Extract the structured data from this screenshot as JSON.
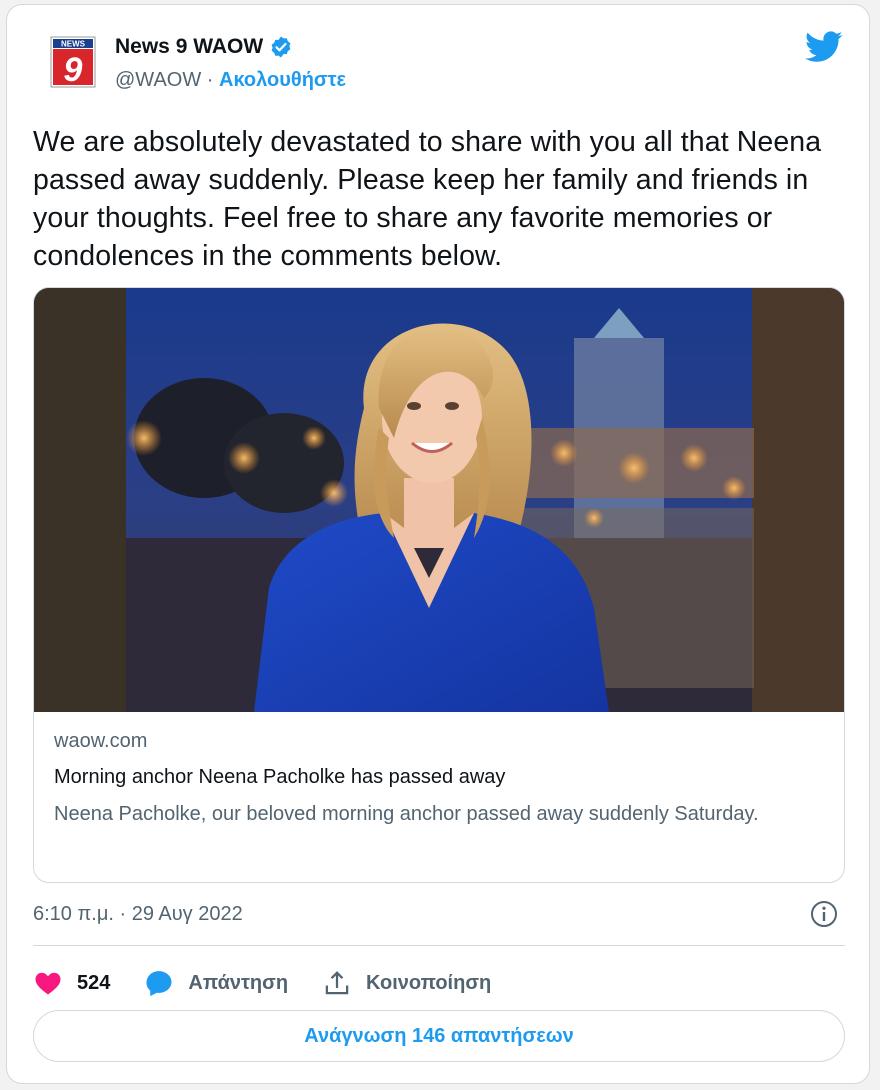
{
  "author": {
    "display_name": "News 9 WAOW",
    "handle": "@WAOW",
    "separator": " · ",
    "follow_label": "Ακολουθήστε",
    "logo_top_text": "NEWS",
    "logo_number": "9"
  },
  "tweet": {
    "text": "We are absolutely devastated to share with you all that Neena passed away suddenly. Please keep her family and friends in your thoughts. Feel free to share any favorite memories or condolences in the comments below."
  },
  "link_card": {
    "domain": "waow.com",
    "title": "Morning anchor Neena Pacholke has passed away",
    "description": "Neena Pacholke, our beloved morning anchor passed away suddenly Saturday."
  },
  "meta": {
    "timestamp": "6:10 π.μ. · 29 Αυγ 2022"
  },
  "actions": {
    "like_count": "524",
    "reply_label": "Απάντηση",
    "share_label": "Κοινοποίηση"
  },
  "read_replies_label": "Ανάγνωση 146 απαντήσεων",
  "colors": {
    "accent": "#1d9bf0",
    "like": "#f91880",
    "muted": "#536471",
    "text": "#0f1419",
    "border": "#cfd9de"
  }
}
